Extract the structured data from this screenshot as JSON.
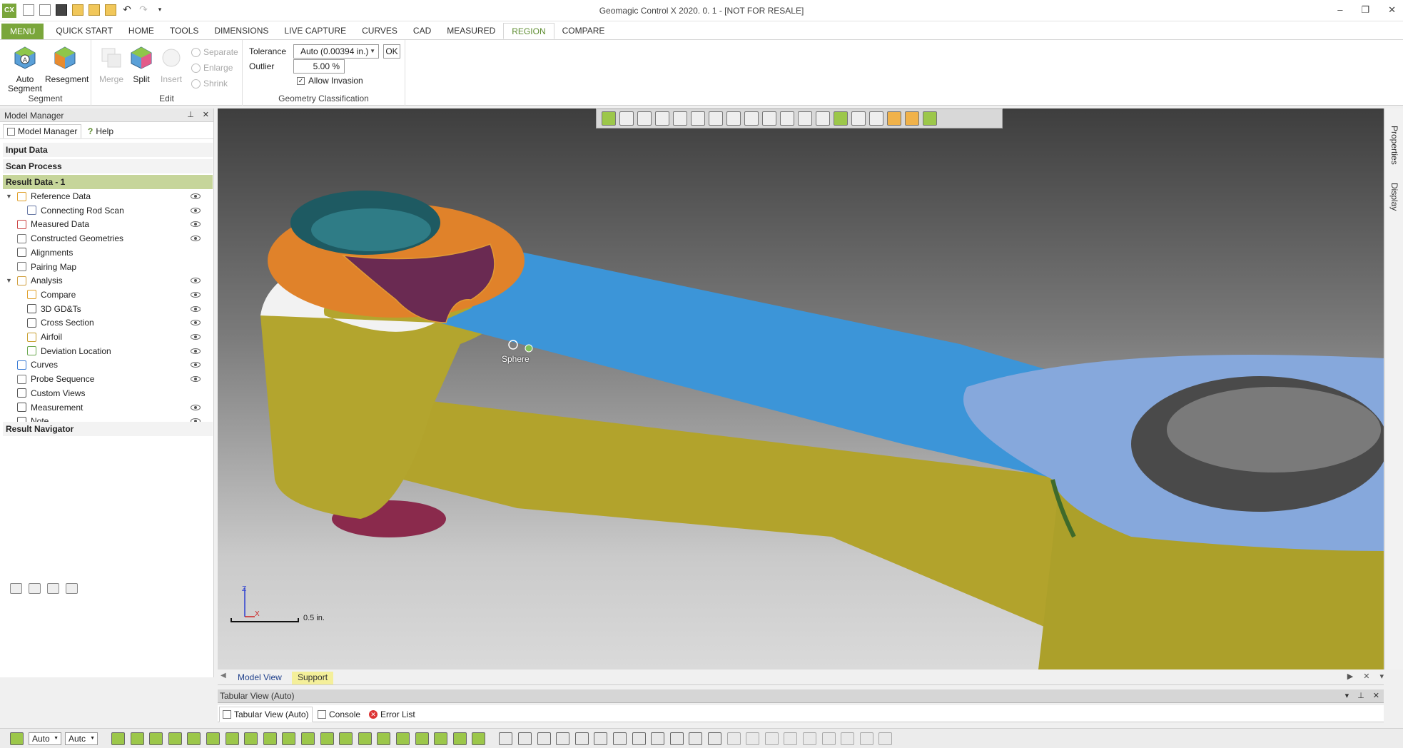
{
  "window": {
    "title": "Geomagic Control X 2020. 0. 1 - [NOT FOR RESALE]",
    "logo": "CX",
    "controls": [
      "–",
      "❐",
      "✕"
    ]
  },
  "ribbon_tabs": [
    "MENU",
    "QUICK START",
    "HOME",
    "TOOLS",
    "DIMENSIONS",
    "LIVE CAPTURE",
    "CURVES",
    "CAD",
    "MEASURED",
    "REGION",
    "COMPARE"
  ],
  "active_tab": "REGION",
  "ribbon": {
    "segment": {
      "label": "Segment",
      "auto_segment": "Auto Segment",
      "resegment": "Resegment"
    },
    "edit": {
      "label": "Edit",
      "merge": "Merge",
      "split": "Split",
      "insert": "Insert",
      "separate": "Separate",
      "enlarge": "Enlarge",
      "shrink": "Shrink"
    },
    "geometry": {
      "label": "Geometry Classification",
      "tolerance_label": "Tolerance",
      "tolerance_value": "Auto (0.00394 in.)",
      "ok": "OK",
      "outlier_label": "Outlier",
      "outlier_value": "5.00 %",
      "allow_invasion": "Allow Invasion"
    }
  },
  "model_manager": {
    "title": "Model Manager",
    "tab_model_manager": "Model Manager",
    "tab_help": "Help",
    "input_data": "Input Data",
    "scan_process": "Scan Process",
    "result_data": "Result Data - 1",
    "tree": [
      {
        "label": "Reference Data",
        "icon": "reference-data-icon",
        "caret": "▼",
        "eye": true
      },
      {
        "label": "Connecting Rod Scan",
        "icon": "scan-icon",
        "caret": "",
        "eye": true
      },
      {
        "label": "Measured Data",
        "icon": "measured-data-icon",
        "caret": "",
        "eye": true
      },
      {
        "label": "Constructed Geometries",
        "icon": "geometry-icon",
        "caret": "",
        "eye": true
      },
      {
        "label": "Alignments",
        "icon": "alignment-icon",
        "caret": "",
        "eye": false
      },
      {
        "label": "Pairing Map",
        "icon": "pairing-map-icon",
        "caret": "",
        "eye": false
      },
      {
        "label": "Analysis",
        "icon": "analysis-icon",
        "caret": "▼",
        "eye": true
      },
      {
        "label": "Compare",
        "icon": "compare-icon",
        "caret": "",
        "eye": true
      },
      {
        "label": "3D GD&Ts",
        "icon": "gdt-icon",
        "caret": "",
        "eye": true
      },
      {
        "label": "Cross Section",
        "icon": "cross-section-icon",
        "caret": "",
        "eye": true
      },
      {
        "label": "Airfoil",
        "icon": "airfoil-icon",
        "caret": "",
        "eye": true
      },
      {
        "label": "Deviation Location",
        "icon": "deviation-location-icon",
        "caret": "",
        "eye": true
      },
      {
        "label": "Curves",
        "icon": "curves-icon",
        "caret": "",
        "eye": true
      },
      {
        "label": "Probe Sequence",
        "icon": "probe-sequence-icon",
        "caret": "",
        "eye": true
      },
      {
        "label": "Custom Views",
        "icon": "custom-views-icon",
        "caret": "",
        "eye": false
      },
      {
        "label": "Measurement",
        "icon": "measurement-icon",
        "caret": "",
        "eye": true
      },
      {
        "label": "Note",
        "icon": "note-icon",
        "caret": "",
        "eye": true
      }
    ],
    "result_navigator": "Result Navigator"
  },
  "viewport": {
    "scale_label": "0.5 in.",
    "axis_z": "Z",
    "axis_x": "X",
    "sphere_label": "Sphere"
  },
  "right_strip": {
    "properties": "Properties",
    "display": "Display"
  },
  "view_tabs": {
    "model_view": "Model View",
    "support": "Support"
  },
  "tabular": {
    "title": "Tabular View (Auto)",
    "tab_tabular": "Tabular View (Auto)",
    "tab_console": "Console",
    "tab_error": "Error List"
  },
  "statusbar": {
    "combo1": "Auto",
    "combo2": "Autc"
  },
  "colors": {
    "accent_green": "#7aa63b",
    "region_orange": "#e0822a",
    "region_yellow": "#b8a92e",
    "region_blue": "#3c95d8",
    "region_light_blue": "#86a8dc",
    "region_purple": "#6a2a52"
  }
}
